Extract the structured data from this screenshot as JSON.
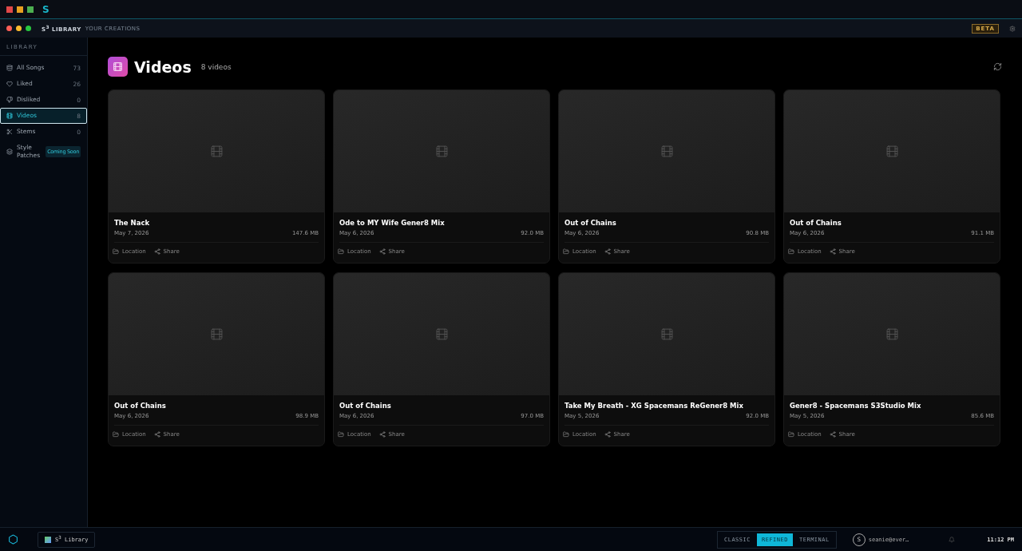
{
  "app_bar": {
    "logo": "S"
  },
  "window": {
    "title": "S$^{3}$ LIBRARY",
    "subtitle": "YOUR CREATIONS",
    "badge": "BETA"
  },
  "sidebar": {
    "heading": "LIBRARY",
    "items": [
      {
        "label": "All Songs",
        "count": "73",
        "selected": false
      },
      {
        "label": "Liked",
        "count": "26",
        "selected": false
      },
      {
        "label": "Disliked",
        "count": "0",
        "selected": false
      },
      {
        "label": "Videos",
        "count": "8",
        "selected": true
      },
      {
        "label": "Stems",
        "count": "0",
        "selected": false
      },
      {
        "label": "Style Patches",
        "tag": "Coming Soon",
        "selected": false
      }
    ]
  },
  "page": {
    "title": "Videos",
    "count": "8 videos"
  },
  "videos": [
    {
      "title": "The Nack",
      "date": "May 7, 2026",
      "size": "147.6 MB",
      "actions": [
        "Location",
        "Share"
      ]
    },
    {
      "title": "Ode to MY Wife Gener8 Mix",
      "date": "May 6, 2026",
      "size": "92.0 MB",
      "actions": [
        "Location",
        "Share"
      ]
    },
    {
      "title": "Out of Chains",
      "date": "May 6, 2026",
      "size": "90.8 MB",
      "actions": [
        "Location",
        "Share"
      ]
    },
    {
      "title": "Out of Chains",
      "date": "May 6, 2026",
      "size": "91.1 MB",
      "actions": [
        "Location",
        "Share"
      ]
    },
    {
      "title": "Out of Chains",
      "date": "May 6, 2026",
      "size": "98.9 MB",
      "actions": [
        "Location",
        "Share"
      ]
    },
    {
      "title": "Out of Chains",
      "date": "May 6, 2026",
      "size": "97.0 MB",
      "actions": [
        "Location",
        "Share"
      ]
    },
    {
      "title": "Take My Breath - XG Spacemans ReGener8 Mix",
      "date": "May 5, 2026",
      "size": "92.0 MB",
      "actions": [
        "Location",
        "Share"
      ]
    },
    {
      "title": "Gener8 - Spacemans S3Studio Mix",
      "date": "May 5, 2026",
      "size": "85.6 MB",
      "actions": [
        "Location",
        "Share"
      ]
    }
  ],
  "taskbar": {
    "app": "S$^{3}$ Library",
    "modes": [
      {
        "label": "CLASSIC",
        "selected": false
      },
      {
        "label": "REFINED",
        "selected": true
      },
      {
        "label": "TERMINAL",
        "selected": false
      }
    ],
    "avatar": "S",
    "user": "seanie@ever…",
    "time": "11:12 PM"
  }
}
